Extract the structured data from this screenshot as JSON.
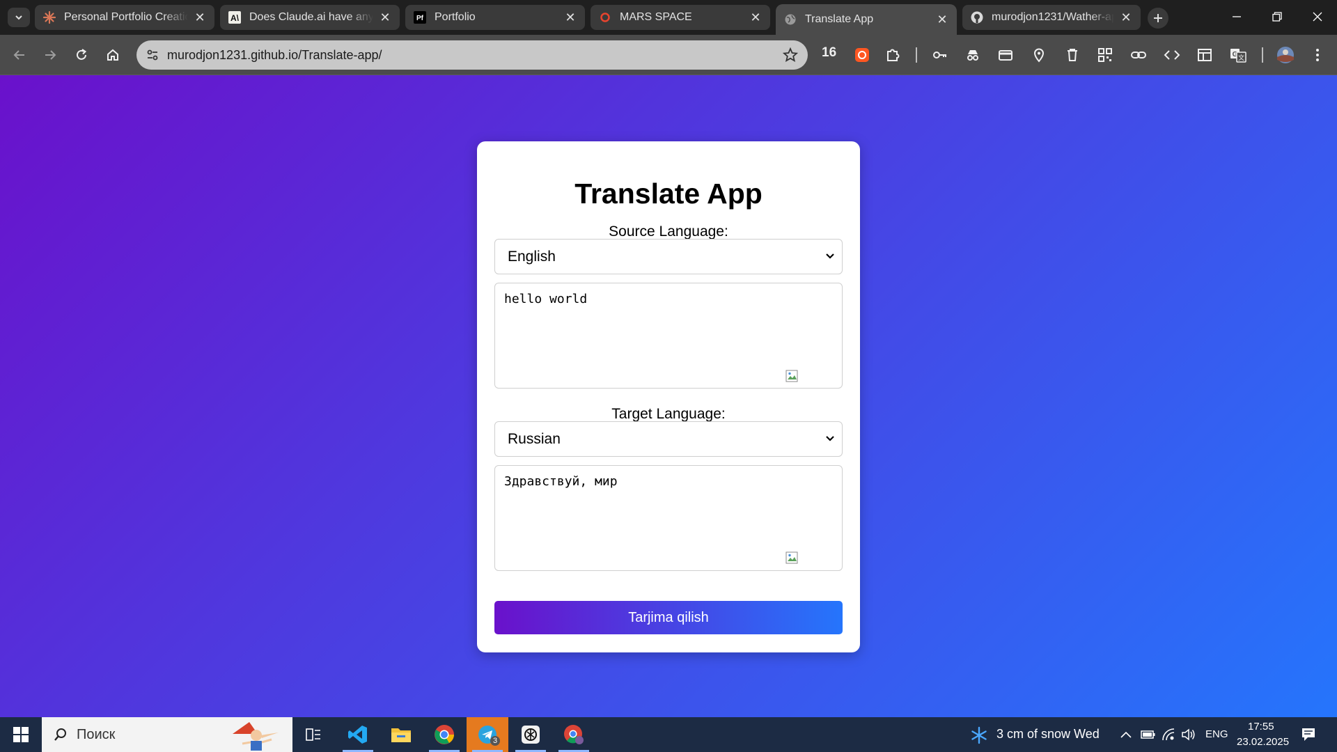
{
  "browser": {
    "tabs": [
      {
        "title": "Personal Portfolio Creation",
        "favicon": "claude-icon",
        "active": false
      },
      {
        "title": "Does Claude.ai have any m",
        "favicon": "anthropic-icon",
        "active": false
      },
      {
        "title": "Portfolio",
        "favicon": "portfolio-pf-icon",
        "favicon_text": "Pf",
        "active": false
      },
      {
        "title": "MARS SPACE",
        "favicon": "mars-icon",
        "active": false
      },
      {
        "title": "Translate App",
        "favicon": "globe-icon",
        "active": true
      },
      {
        "title": "murodjon1231/Wather-ap",
        "favicon": "github-icon",
        "active": false
      }
    ],
    "url": "murodjon1231.github.io/Translate-app/",
    "extension_badge": "16"
  },
  "app": {
    "title": "Translate App",
    "source_label": "Source Language:",
    "source_language": "English",
    "source_text": "hello world",
    "target_label": "Target Language:",
    "target_language": "Russian",
    "target_text": "Здравствуй, мир",
    "broken_image_alt_1": "e",
    "broken_image_alt_2": "e",
    "translate_button": "Tarjima qilish",
    "colors": {
      "gradient_start": "#6a11cb",
      "gradient_end": "#2575fc"
    }
  },
  "taskbar": {
    "search_placeholder": "Поиск",
    "weather": "3 cm of snow Wed",
    "language": "ENG",
    "time": "17:55",
    "date": "23.02.2025",
    "telegram_badge": "3"
  }
}
